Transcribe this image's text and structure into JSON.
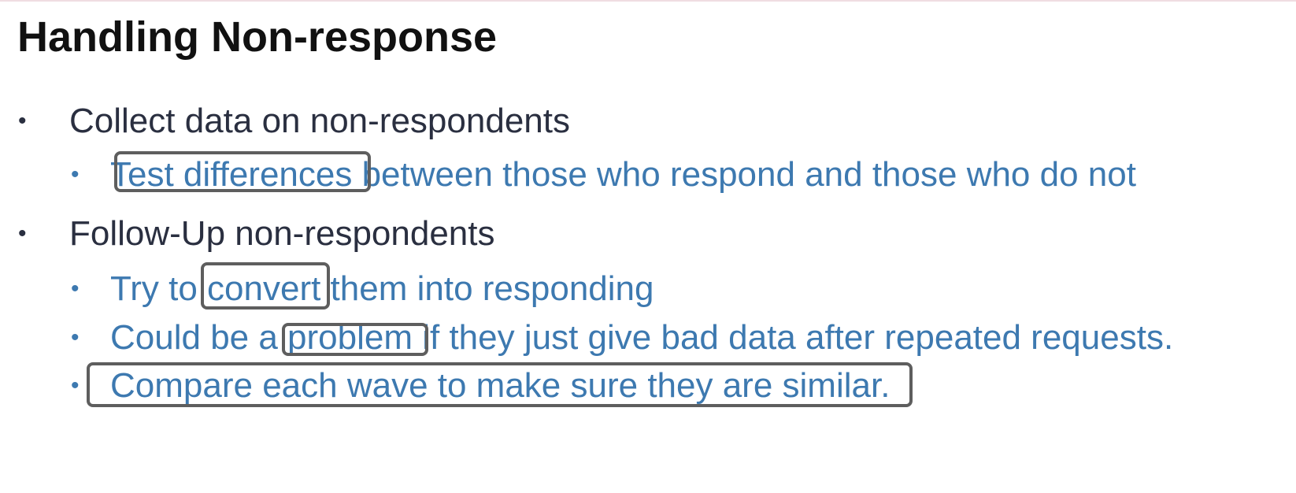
{
  "slide": {
    "title": "Handling Non-response",
    "bullets": [
      {
        "text": "Collect data on non-respondents",
        "sub": [
          "Test differences between those who respond and those who do not"
        ]
      },
      {
        "text": "Follow-Up non-respondents",
        "sub": [
          "Try to convert them into responding",
          "Could be a problem if they just give bad data after repeated requests.",
          "Compare each wave to make sure they are similar."
        ]
      }
    ],
    "bullet_glyph": "•",
    "highlighted_phrases": [
      "Test differences",
      "convert",
      "problem",
      "Compare each wave to make sure they are similar."
    ]
  },
  "colors": {
    "title": "#111111",
    "level1_text": "#2a2f40",
    "level2_text": "#3d79b0",
    "highlight_box": "#5e5e5e"
  }
}
